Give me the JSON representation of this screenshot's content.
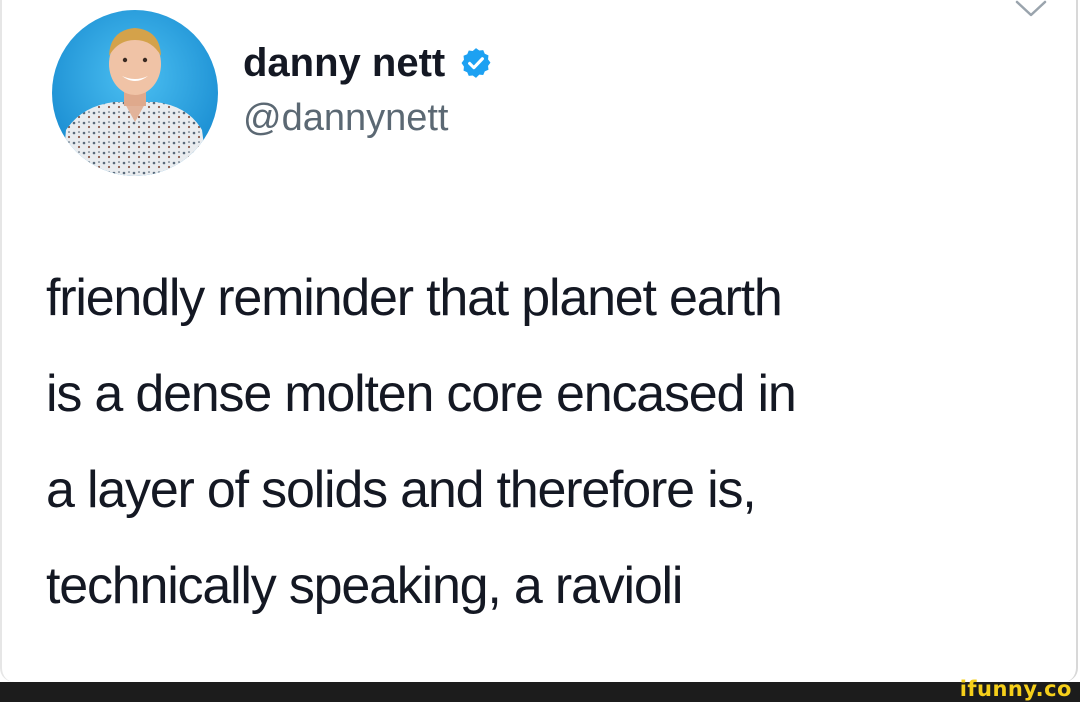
{
  "tweet": {
    "author": {
      "display_name": "danny nett",
      "handle": "@dannynett",
      "verified": true
    },
    "text_lines": [
      "friendly reminder that planet earth",
      "is a dense molten core encased in",
      "a layer of solids and therefore is,",
      "technically speaking, a ravioli"
    ],
    "menu_icon": "chevron-down-icon"
  },
  "watermark": {
    "text": "ifunny.co"
  },
  "colors": {
    "verified_blue": "#1da1f2",
    "text_primary": "#141823",
    "text_secondary": "#5b6873",
    "avatar_background": "#1e9ee0",
    "watermark_yellow": "#f5cf1a",
    "bottom_bar": "#1c1c1c"
  }
}
